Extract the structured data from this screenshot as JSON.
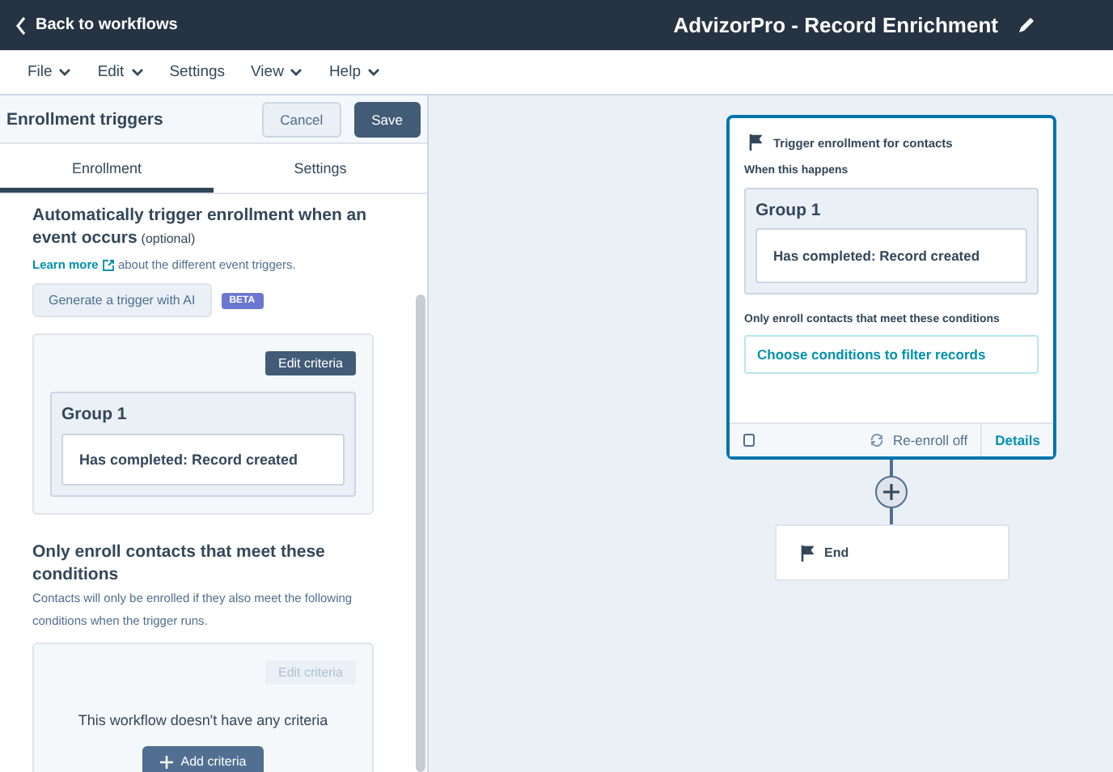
{
  "header": {
    "back_link": "Back to workflows",
    "title": "AdvizorPro - Record Enrichment"
  },
  "menu": [
    {
      "label": "File",
      "dropdown": true
    },
    {
      "label": "Edit",
      "dropdown": true
    },
    {
      "label": "Settings",
      "dropdown": false
    },
    {
      "label": "View",
      "dropdown": true
    },
    {
      "label": "Help",
      "dropdown": true
    }
  ],
  "panel": {
    "title": "Enrollment triggers",
    "buttons": [
      {
        "label": "Cancel",
        "kind": "secondary"
      },
      {
        "label": "Save",
        "kind": "primary"
      }
    ],
    "tabs": [
      {
        "label": "Enrollment",
        "selected": true
      },
      {
        "label": "Settings",
        "selected": false
      }
    ],
    "trigger_section": {
      "heading": "Automatically trigger enrollment when an event occurs",
      "note": "(optional)",
      "learn_more": "Learn more",
      "learn_more_text": "about the different event triggers.",
      "ai_button": "Generate a trigger with AI",
      "badge": "BETA",
      "edit_button": {
        "label": "Edit criteria",
        "disabled": false
      },
      "group": {
        "title": "Group 1",
        "criterion": "Has completed: Record created"
      }
    },
    "filter_section": {
      "heading": "Only enroll contacts that meet these conditions",
      "description": "Contacts will only be enrolled if they also meet the following conditions when the trigger runs.",
      "edit_button": {
        "label": "Edit criteria",
        "disabled": true
      },
      "empty_text": "This workflow doesn't have any criteria",
      "add_button": "Add criteria"
    }
  },
  "canvas": {
    "trigger_card": {
      "selected": true,
      "title": "Trigger enrollment for contacts",
      "when_label": "When this happens",
      "group": {
        "title": "Group 1",
        "criterion": "Has completed: Record created"
      },
      "filter_label": "Only enroll contacts that meet these conditions",
      "filter_link": "Choose conditions to filter records",
      "reenroll": "Re-enroll off",
      "details": "Details"
    },
    "end_card": {
      "label": "End"
    }
  }
}
